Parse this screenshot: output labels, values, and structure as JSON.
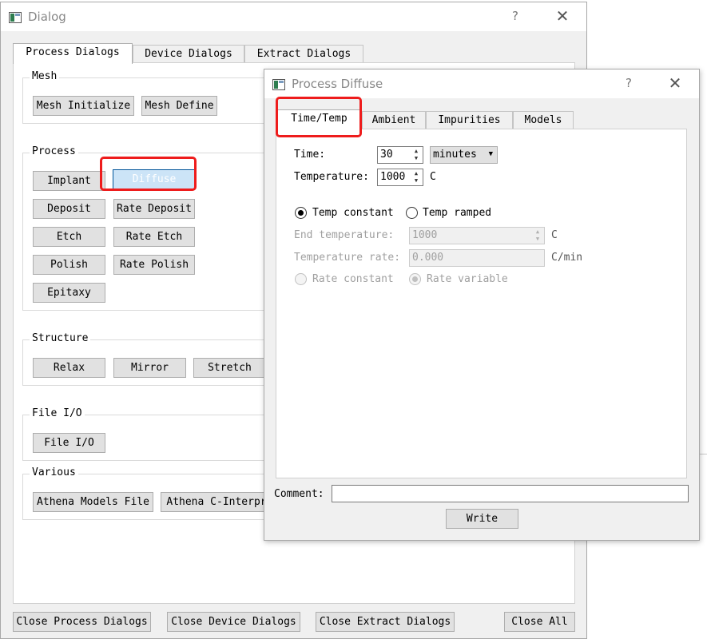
{
  "main_dialog": {
    "title": "Dialog",
    "help": "?",
    "close": "✕",
    "tabs": [
      "Process Dialogs",
      "Device Dialogs",
      "Extract Dialogs"
    ],
    "groups": {
      "mesh": {
        "title": "Mesh",
        "buttons": [
          "Mesh Initialize",
          "Mesh Define"
        ]
      },
      "process": {
        "title": "Process",
        "buttons": [
          "Implant",
          "Diffuse",
          "Deposit",
          "Rate Deposit",
          "Etch",
          "Rate Etch",
          "Polish",
          "Rate Polish",
          "Epitaxy"
        ]
      },
      "structure": {
        "title": "Structure",
        "buttons": [
          "Relax",
          "Mirror",
          "Stretch"
        ]
      },
      "fileio": {
        "title": "File I/O",
        "buttons": [
          "File I/O"
        ]
      },
      "various": {
        "title": "Various",
        "buttons": [
          "Athena Models File",
          "Athena C-Interpr"
        ]
      }
    },
    "bottom_buttons": [
      "Close Process Dialogs",
      "Close Device Dialogs",
      "Close Extract Dialogs",
      "Close All"
    ]
  },
  "diffuse_dialog": {
    "title": "Process Diffuse",
    "help": "?",
    "close": "✕",
    "tabs": [
      "Time/Temp",
      "Ambient",
      "Impurities",
      "Models"
    ],
    "time_label": "Time:",
    "time_value": "30",
    "time_unit": "minutes",
    "temperature_label": "Temperature:",
    "temperature_value": "1000",
    "temperature_unit": "C",
    "radio_temp_constant": "Temp constant",
    "radio_temp_ramped": "Temp ramped",
    "end_temp_label": "End temperature:",
    "end_temp_value": "1000",
    "end_temp_unit": "C",
    "temp_rate_label": "Temperature rate:",
    "temp_rate_value": "0.000",
    "temp_rate_unit": "C/min",
    "radio_rate_constant": "Rate constant",
    "radio_rate_variable": "Rate variable",
    "comment_label": "Comment:",
    "comment_value": "",
    "write_button": "Write"
  },
  "colors": {
    "highlight": "#ee1c1c",
    "selected_button": "#cce4f7",
    "window_bg": "#f0f0f0"
  },
  "icons": [
    "app-window-icon",
    "help-icon",
    "close-icon",
    "spin-up-icon",
    "spin-down-icon",
    "dropdown-arrow-icon"
  ]
}
